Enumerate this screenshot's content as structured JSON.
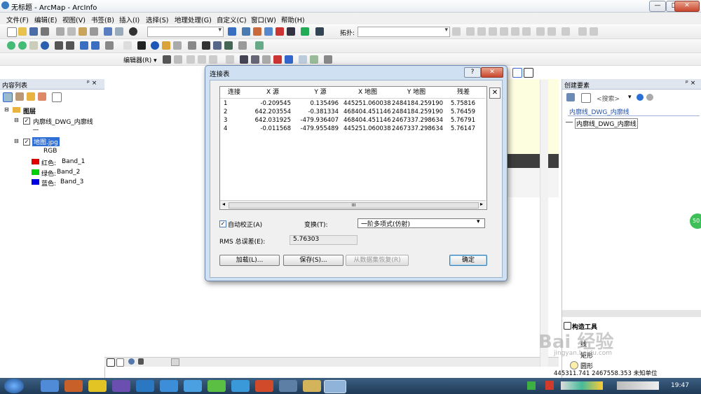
{
  "window": {
    "title": "无标题 - ArcMap - ArcInfo",
    "btn_min": "—",
    "btn_max": "□",
    "btn_close": "✕"
  },
  "menu": [
    "文件(F)",
    "编辑(E)",
    "视图(V)",
    "书签(B)",
    "插入(I)",
    "选择(S)",
    "地理处理(G)",
    "自定义(C)",
    "窗口(W)",
    "帮助(H)"
  ],
  "toolbar": {
    "topology_label": "拓扑:",
    "editor_label": "编辑器(R) ▾"
  },
  "toc": {
    "title": "内容列表",
    "pin": "ᵖ ×",
    "layers_label": "图层",
    "layer1": "内廓线_DWG_内廓线",
    "layer2": "地图.jpg",
    "rgb": "RGB",
    "bands": [
      {
        "label": "红色:",
        "band": "Band_1",
        "color": "#e00000"
      },
      {
        "label": "绿色:",
        "band": "Band_2",
        "color": "#00d000"
      },
      {
        "label": "蓝色:",
        "band": "Band_3",
        "color": "#0000e0"
      }
    ]
  },
  "dialog": {
    "title": "连接表",
    "help_btn": "?",
    "close_btn": "✕",
    "remove_btn": "✕",
    "columns": [
      "连接",
      "X 源",
      "Y 源",
      "X 地图",
      "Y 地图",
      "残差"
    ],
    "rows": [
      [
        "1",
        "-0.209545",
        "0.135496",
        "445251.060038",
        "2484184.259190",
        "5.75816"
      ],
      [
        "2",
        "642.203554",
        "-0.381334",
        "468404.451146",
        "2484184.259190",
        "5.76459"
      ],
      [
        "3",
        "642.031925",
        "-479.936407",
        "468404.451146",
        "2467337.298634",
        "5.76791"
      ],
      [
        "4",
        "-0.011568",
        "-479.955489",
        "445251.060038",
        "2467337.298634",
        "5.76147"
      ]
    ],
    "scroll_mid": "III",
    "auto_adjust": "自动校正(A)",
    "transform_label": "变换(T):",
    "transform_value": "一阶多项式(仿射)",
    "rms_label": "RMS 总误差(E):",
    "rms_value": "5.76303",
    "load_btn": "加载(L)...",
    "save_btn": "保存(S)...",
    "restore_btn": "从数据集恢复(R)",
    "ok_btn": "确定"
  },
  "right_panel": {
    "title": "创建要素",
    "pin": "ᵖ ×",
    "search_placeholder": "<搜索>",
    "group": "内廓线_DWG_内廓线",
    "item": "内廓线_DWG_内廓线",
    "construct_title": "构造工具",
    "tools": [
      "线",
      "矩形",
      "圆形"
    ],
    "badge": "50"
  },
  "statusbar": {
    "coords": "445311.741  2467558.353 未知单位"
  },
  "watermark": {
    "text": "Bai 经验",
    "sub": "jingyan.baidu.com"
  },
  "taskbar": {
    "time": "19:47"
  }
}
